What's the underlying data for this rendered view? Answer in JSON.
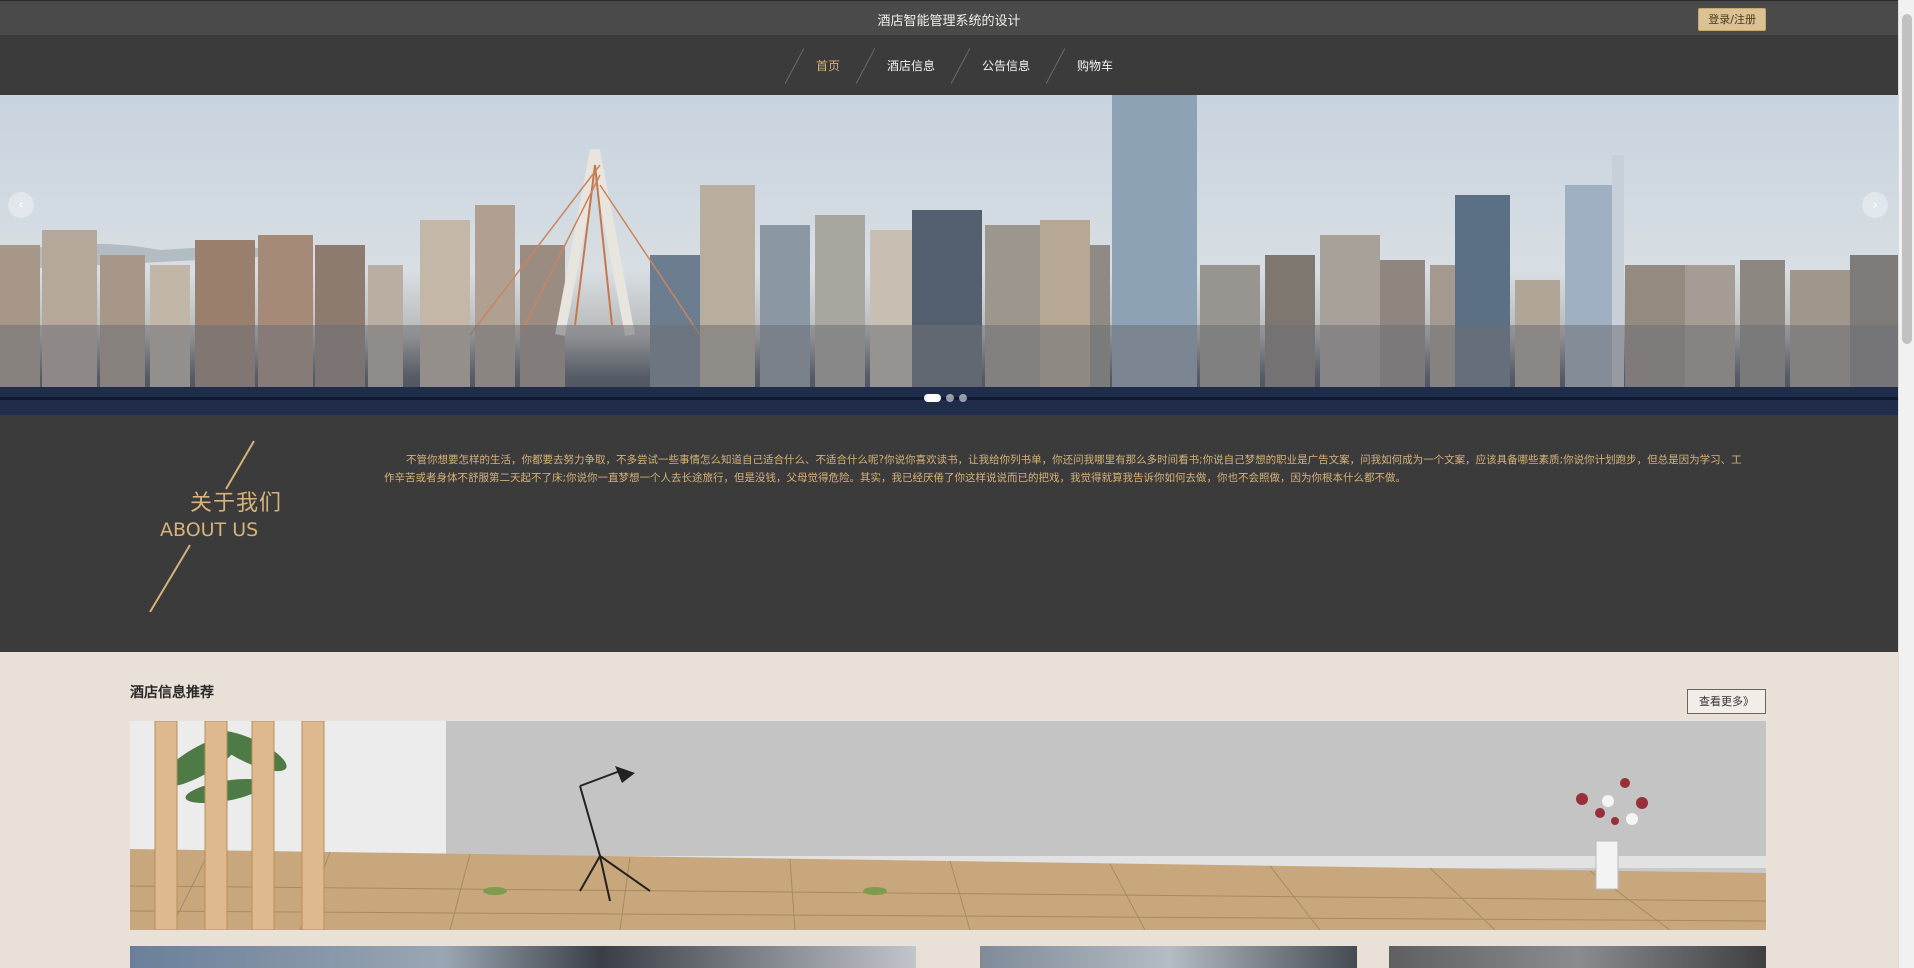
{
  "header": {
    "site_title": "酒店智能管理系统的设计",
    "login_label": "登录/注册"
  },
  "nav": {
    "items": [
      {
        "label": "首页",
        "active": true
      },
      {
        "label": "酒店信息",
        "active": false
      },
      {
        "label": "公告信息",
        "active": false
      },
      {
        "label": "购物车",
        "active": false
      }
    ]
  },
  "banner": {
    "prev_icon": "‹",
    "next_icon": "›",
    "slide_count": 3,
    "active_slide": 1
  },
  "about": {
    "title_cn": "关于我们",
    "title_en": "ABOUT US",
    "body": "不管你想要怎样的生活，你都要去努力争取，不多尝试一些事情怎么知道自己适合什么、不适合什么呢?你说你喜欢读书，让我给你列书单，你还问我哪里有那么多时间看书;你说自己梦想的职业是广告文案，问我如何成为一个文案，应该具备哪些素质;你说你计划跑步，但总是因为学习、工作辛苦或者身体不舒服第二天起不了床;你说你一直梦想一个人去长途旅行，但是没钱，父母觉得危险。其实，我已经厌倦了你这样说说而已的把戏，我觉得就算我告诉你如何去做，你也不会照做，因为你根本什么都不做。"
  },
  "hotel_section": {
    "title": "酒店信息推荐",
    "more_label": "查看更多》"
  },
  "colors": {
    "accent_gold": "#d7b27a",
    "dark_bg": "#3b3b3b",
    "page_bg": "#e9e1d8"
  }
}
